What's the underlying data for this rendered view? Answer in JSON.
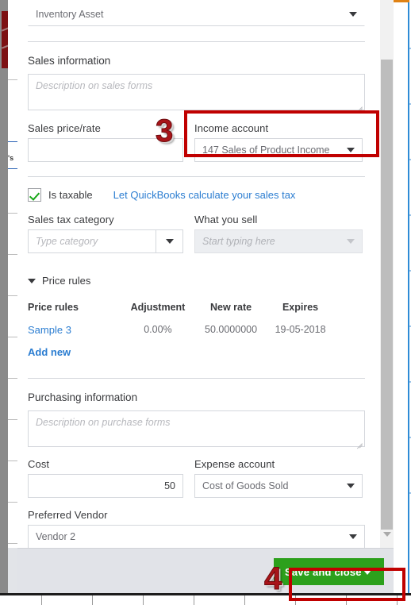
{
  "product_form": {
    "inventory_asset_account": {
      "value": "Inventory Asset",
      "caret_icon": "chevron-down-icon"
    },
    "sales_information": {
      "heading": "Sales information",
      "description_placeholder": "Description on sales forms",
      "description_value": "",
      "sales_price_rate": {
        "label": "Sales price/rate",
        "value": ""
      },
      "income_account": {
        "label": "Income account",
        "value": "147 Sales of Product Income",
        "caret_icon": "chevron-down-icon"
      }
    },
    "tax": {
      "is_taxable_label": "Is taxable",
      "is_taxable_checked": true,
      "check_icon": "checkmark-icon",
      "calc_tax_link": "Let QuickBooks calculate your sales tax",
      "sales_tax_category": {
        "label": "Sales tax category",
        "value": "",
        "placeholder": "Type category",
        "caret_icon": "chevron-down-icon"
      },
      "what_you_sell": {
        "label": "What you sell",
        "value": "",
        "placeholder": "Start typing here",
        "disabled": true,
        "caret_icon": "chevron-down-icon"
      }
    },
    "price_rules": {
      "toggle_label": "Price rules",
      "toggle_icon": "chevron-down-icon",
      "columns": [
        "Price rules",
        "Adjustment",
        "New rate",
        "Expires"
      ],
      "rows": [
        {
          "name": "Sample 3",
          "adjustment": "0.00%",
          "new_rate": "50.0000000",
          "expires": "19-05-2018"
        }
      ],
      "add_new_label": "Add new"
    },
    "purchasing_information": {
      "heading": "Purchasing information",
      "description_placeholder": "Description on purchase forms",
      "description_value": "",
      "cost": {
        "label": "Cost",
        "value": "50"
      },
      "expense_account": {
        "label": "Expense account",
        "value": "Cost of Goods Sold",
        "caret_icon": "chevron-down-icon"
      },
      "preferred_vendor": {
        "label": "Preferred Vendor",
        "value": "Vendor 2",
        "caret_icon": "chevron-down-icon"
      }
    },
    "footer": {
      "save_and_close_label": "Save and close",
      "save_caret_icon": "chevron-down-icon"
    },
    "scrollbar": {
      "down_arrow_icon": "chevron-down-icon"
    }
  },
  "annotations": [
    {
      "number": "3",
      "target": "income-account-field"
    },
    {
      "number": "4",
      "target": "save-and-close-button"
    }
  ],
  "colors": {
    "brand_green": "#2CA01C",
    "link_blue": "#2B7DD1",
    "annotation_red": "#C00000",
    "annotation_number_red": "#A81419",
    "check_green": "#18A718",
    "footer_gray": "#E1E3E8"
  }
}
